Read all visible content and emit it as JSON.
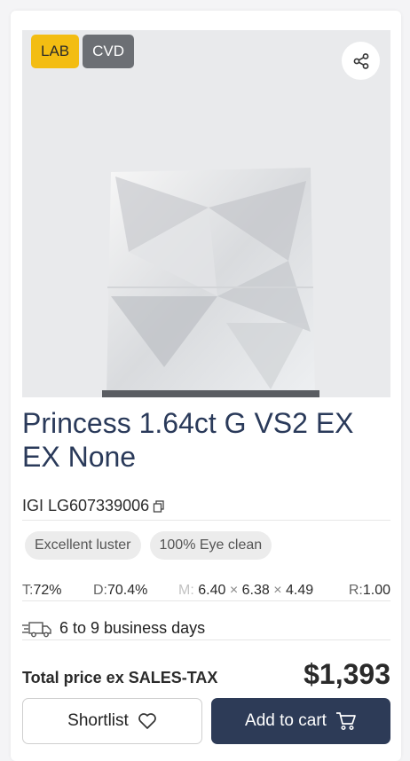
{
  "badges": {
    "lab": "LAB",
    "cvd": "CVD"
  },
  "product": {
    "title": "Princess 1.64ct G VS2 EX EX None",
    "certificate": "IGI LG607339006"
  },
  "chips": [
    "Excellent luster",
    "100% Eye clean"
  ],
  "specs": {
    "table_label": "T:",
    "table_value": "72%",
    "depth_label": "D:",
    "depth_value": "70.4%",
    "measure_label": "M:",
    "m1": "6.40",
    "sep1": "×",
    "m2": "6.38",
    "sep2": "×",
    "m3": "4.49",
    "ratio_label": "R:",
    "ratio_value": "1.00"
  },
  "delivery": "6 to 9 business days",
  "price": {
    "label": "Total price ex SALES-TAX",
    "value": "$1,393"
  },
  "actions": {
    "shortlist": "Shortlist",
    "add_to_cart": "Add to cart"
  },
  "icons": [
    "share-icon",
    "copy-icon",
    "delivery-truck-icon",
    "heart-icon",
    "cart-icon"
  ],
  "colors": {
    "lab_badge": "#f3bd12",
    "cvd_badge": "#6c6f74",
    "primary": "#2d3b57",
    "title": "#2a3a5a"
  }
}
